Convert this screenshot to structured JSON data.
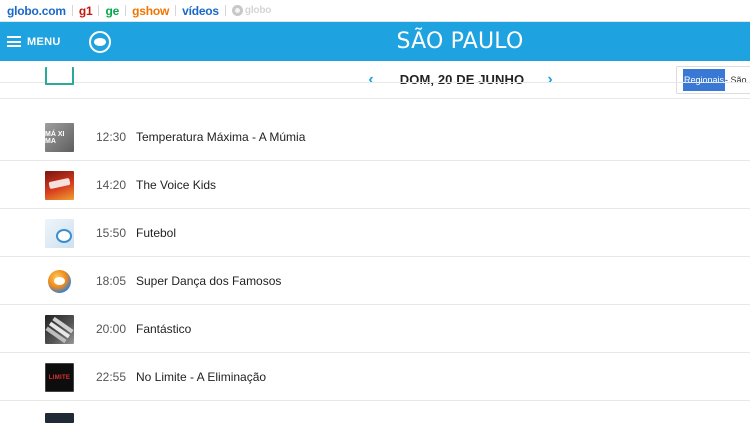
{
  "topbar": {
    "links": {
      "globo": "globo.com",
      "g1": "g1",
      "ge": "ge",
      "gshow": "gshow",
      "videos": "vídeos"
    },
    "globoplay_label": "globo"
  },
  "header": {
    "menu_label": "MENU",
    "city": "SÃO PAULO",
    "background_color": "#1fa3e0"
  },
  "datebar": {
    "date": "DOM, 20 DE JUNHO",
    "prev_icon": "chevron-left-icon",
    "next_icon": "chevron-right-icon",
    "region_selected": "Regionais",
    "region_rest": " - São"
  },
  "schedule": [
    {
      "time": "12:30",
      "title": "Temperatura Máxima - A Múmia",
      "thumb_text": "MÁ XI MA"
    },
    {
      "time": "14:20",
      "title": "The Voice Kids"
    },
    {
      "time": "15:50",
      "title": "Futebol"
    },
    {
      "time": "18:05",
      "title": "Super Dança dos Famosos"
    },
    {
      "time": "20:00",
      "title": "Fantástico"
    },
    {
      "time": "22:55",
      "title": "No Limite - A Eliminação",
      "thumb_text": "LIMITE"
    }
  ]
}
